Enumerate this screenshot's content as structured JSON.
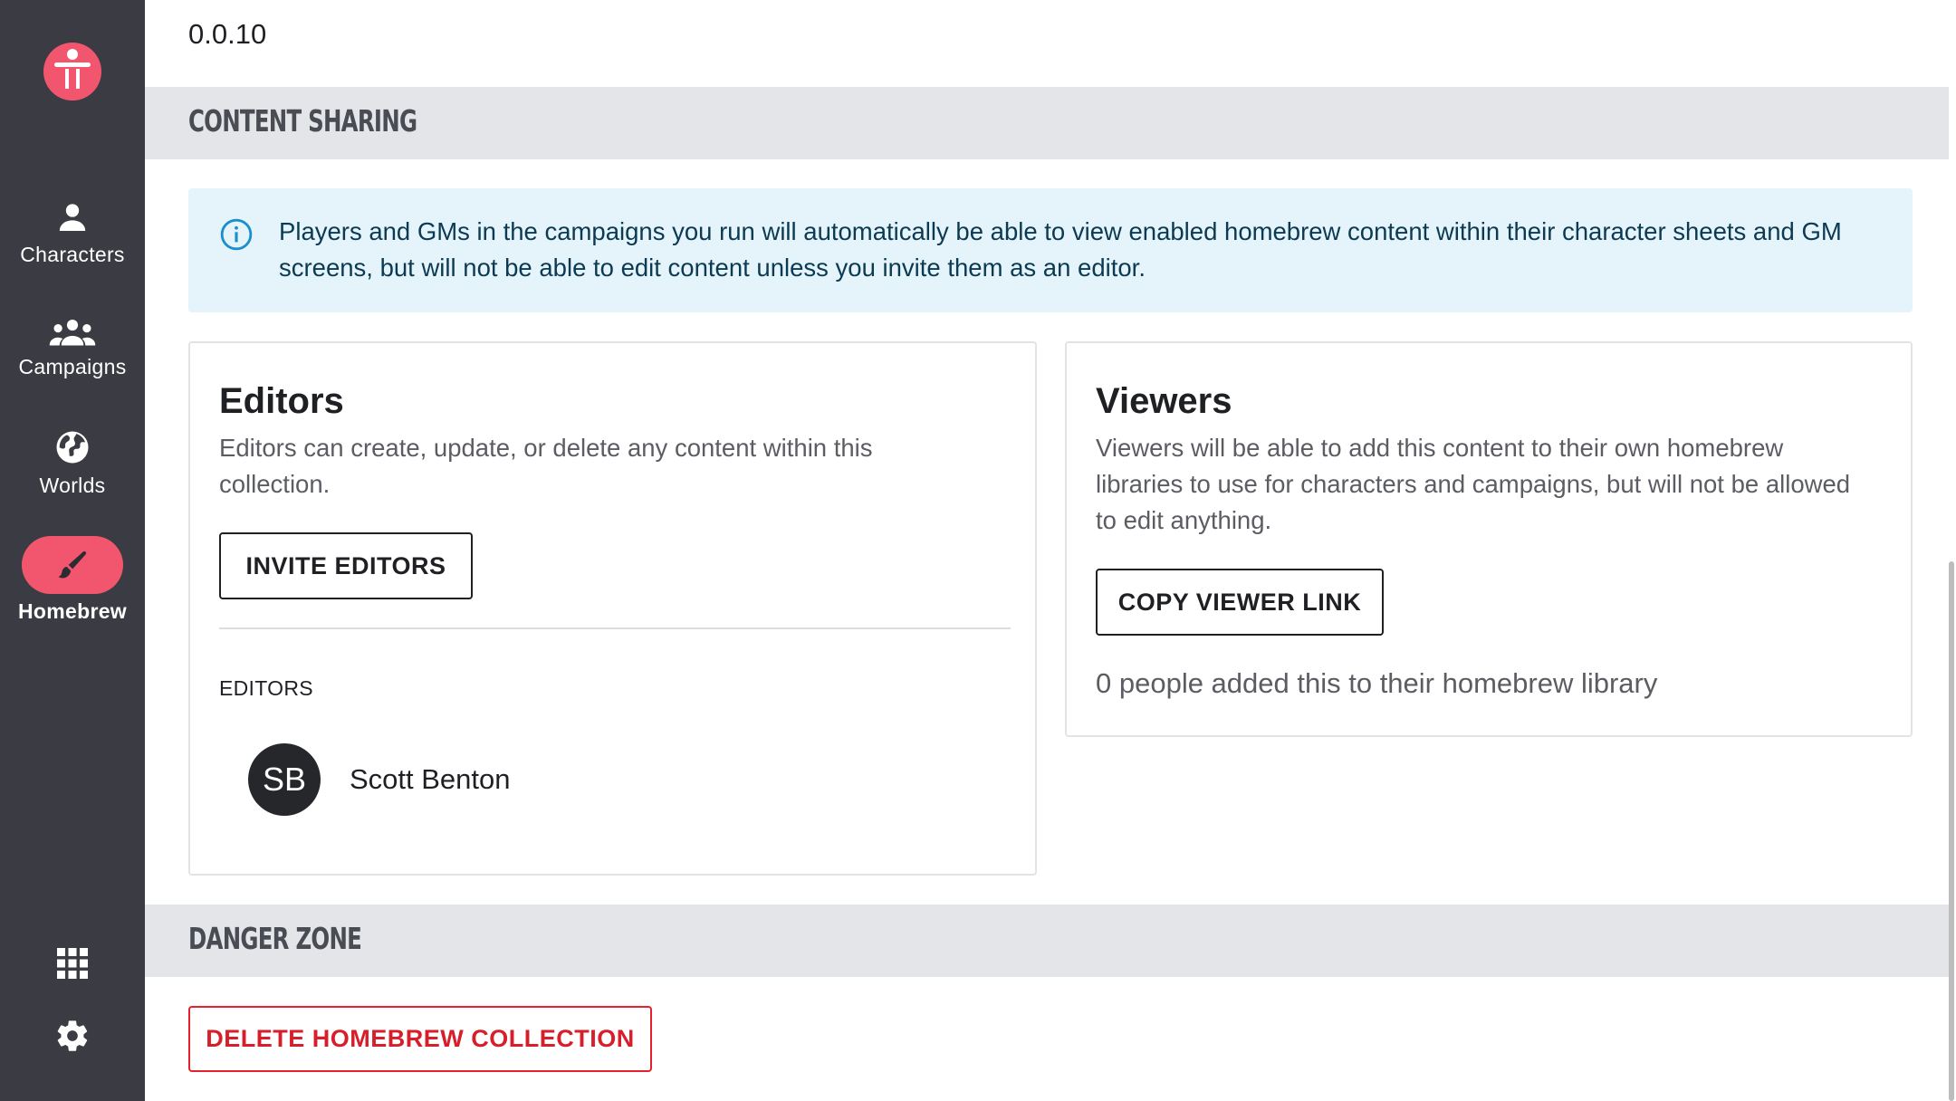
{
  "sidebar": {
    "logo_icon": "tablekit-logo",
    "items": [
      {
        "label": "Characters",
        "icon": "person-icon"
      },
      {
        "label": "Campaigns",
        "icon": "group-icon"
      },
      {
        "label": "Worlds",
        "icon": "globe-icon"
      },
      {
        "label": "Homebrew",
        "icon": "brush-icon",
        "active": true
      }
    ],
    "bottom_icons": [
      "apps-grid-icon",
      "gear-icon"
    ],
    "accent_color": "#f2566e",
    "background_color": "#3b3c43"
  },
  "main": {
    "version": "0.0.10",
    "content_sharing": {
      "title": "Content Sharing",
      "info": "Players and GMs in the campaigns you run will automatically be able to view enabled homebrew content within their character sheets and GM screens, but will not be able to edit content unless you invite them as an editor.",
      "editors_card": {
        "title": "Editors",
        "description": "Editors can create, update, or delete any content within this collection.",
        "button": "INVITE EDITORS",
        "list_label": "EDITORS",
        "editors": [
          {
            "initials": "SB",
            "name": "Scott Benton"
          }
        ]
      },
      "viewers_card": {
        "title": "Viewers",
        "description": "Viewers will be able to add this content to their own homebrew libraries to use for characters and campaigns, but will not be allowed to edit anything.",
        "button": "COPY VIEWER LINK",
        "count_text": "0 people added this to their homebrew library"
      }
    },
    "danger_zone": {
      "title": "Danger Zone",
      "button": "DELETE HOMEBREW COLLECTION",
      "danger_color": "#d71f2c"
    }
  }
}
